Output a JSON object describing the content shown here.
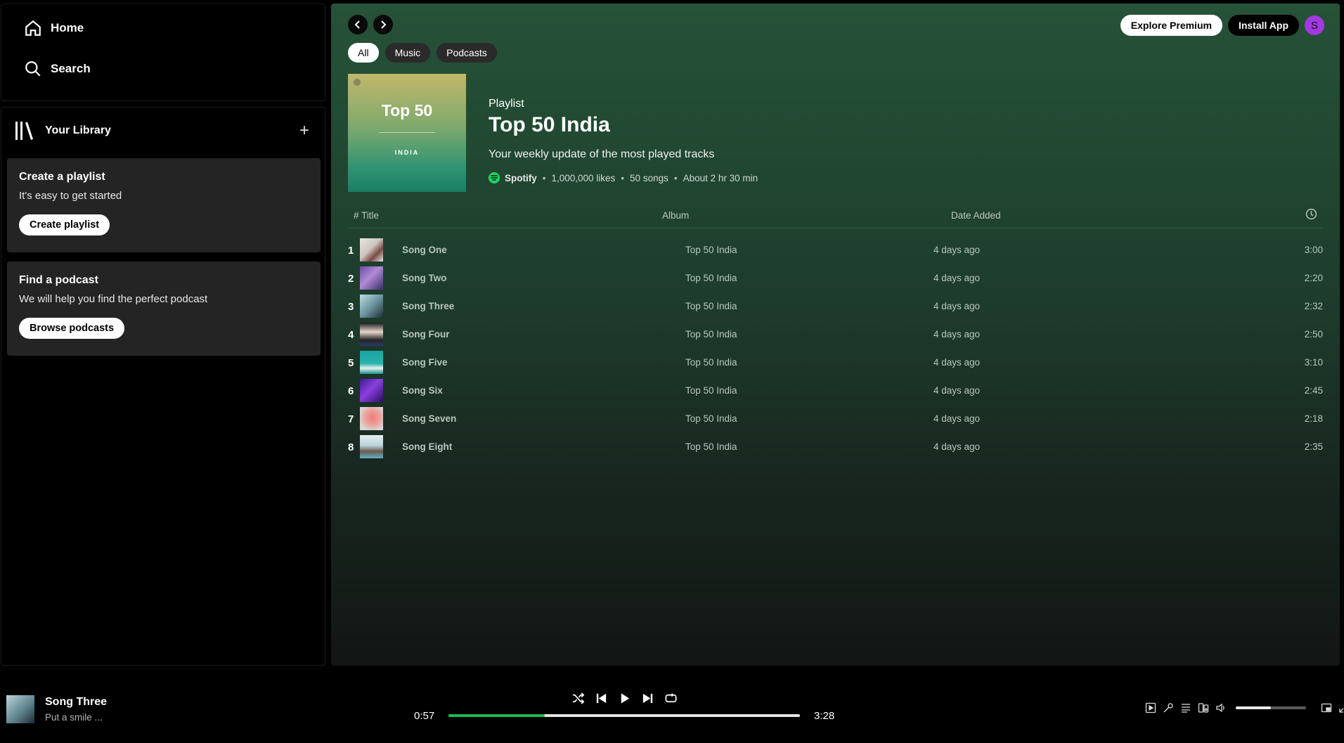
{
  "sidebar": {
    "home_label": "Home",
    "search_label": "Search",
    "library_label": "Your Library",
    "add_label": "+",
    "create_card": {
      "title": "Create a playlist",
      "text": "It's easy to get started",
      "button": "Create playlist"
    },
    "podcast_card": {
      "title": "Find a podcast",
      "text": "We will help you find the perfect podcast",
      "button": "Browse podcasts"
    }
  },
  "header": {
    "explore_label": "Explore Premium",
    "install_label": "Install App",
    "avatar_letter": "S",
    "filters": [
      "All",
      "Music",
      "Podcasts"
    ],
    "active_filter": "All"
  },
  "playlist": {
    "cover_title": "Top 50",
    "cover_subtitle": "INDIA",
    "type": "Playlist",
    "title": "Top 50 India",
    "description": "Your weekly update of the most played tracks",
    "owner": "Spotify",
    "likes": "1,000,000 likes",
    "songs": "50 songs",
    "duration": "About 2 hr 30 min"
  },
  "table": {
    "headers": {
      "title": "# Title",
      "album": "Album",
      "date": "Date Added"
    },
    "tracks": [
      {
        "num": "1",
        "title": "Song One",
        "album": "Top 50 India",
        "added": "4 days ago",
        "duration": "3:00"
      },
      {
        "num": "2",
        "title": "Song Two",
        "album": "Top 50 India",
        "added": "4 days ago",
        "duration": "2:20"
      },
      {
        "num": "3",
        "title": "Song Three",
        "album": "Top 50 India",
        "added": "4 days ago",
        "duration": "2:32"
      },
      {
        "num": "4",
        "title": "Song Four",
        "album": "Top 50 India",
        "added": "4 days ago",
        "duration": "2:50"
      },
      {
        "num": "5",
        "title": "Song Five",
        "album": "Top 50 India",
        "added": "4 days ago",
        "duration": "3:10"
      },
      {
        "num": "6",
        "title": "Song Six",
        "album": "Top 50 India",
        "added": "4 days ago",
        "duration": "2:45"
      },
      {
        "num": "7",
        "title": "Song Seven",
        "album": "Top 50 India",
        "added": "4 days ago",
        "duration": "2:18"
      },
      {
        "num": "8",
        "title": "Song Eight",
        "album": "Top 50 India",
        "added": "4 days ago",
        "duration": "2:35"
      }
    ]
  },
  "player": {
    "now_playing_title": "Song Three",
    "now_playing_subtitle": "Put a smile ...",
    "elapsed": "0:57",
    "total": "3:28",
    "progress_fraction": 0.274,
    "volume_fraction": 0.5
  },
  "colors": {
    "accent": "#1db954",
    "avatar": "#a239e0",
    "main_gradient_top": "#265238"
  }
}
